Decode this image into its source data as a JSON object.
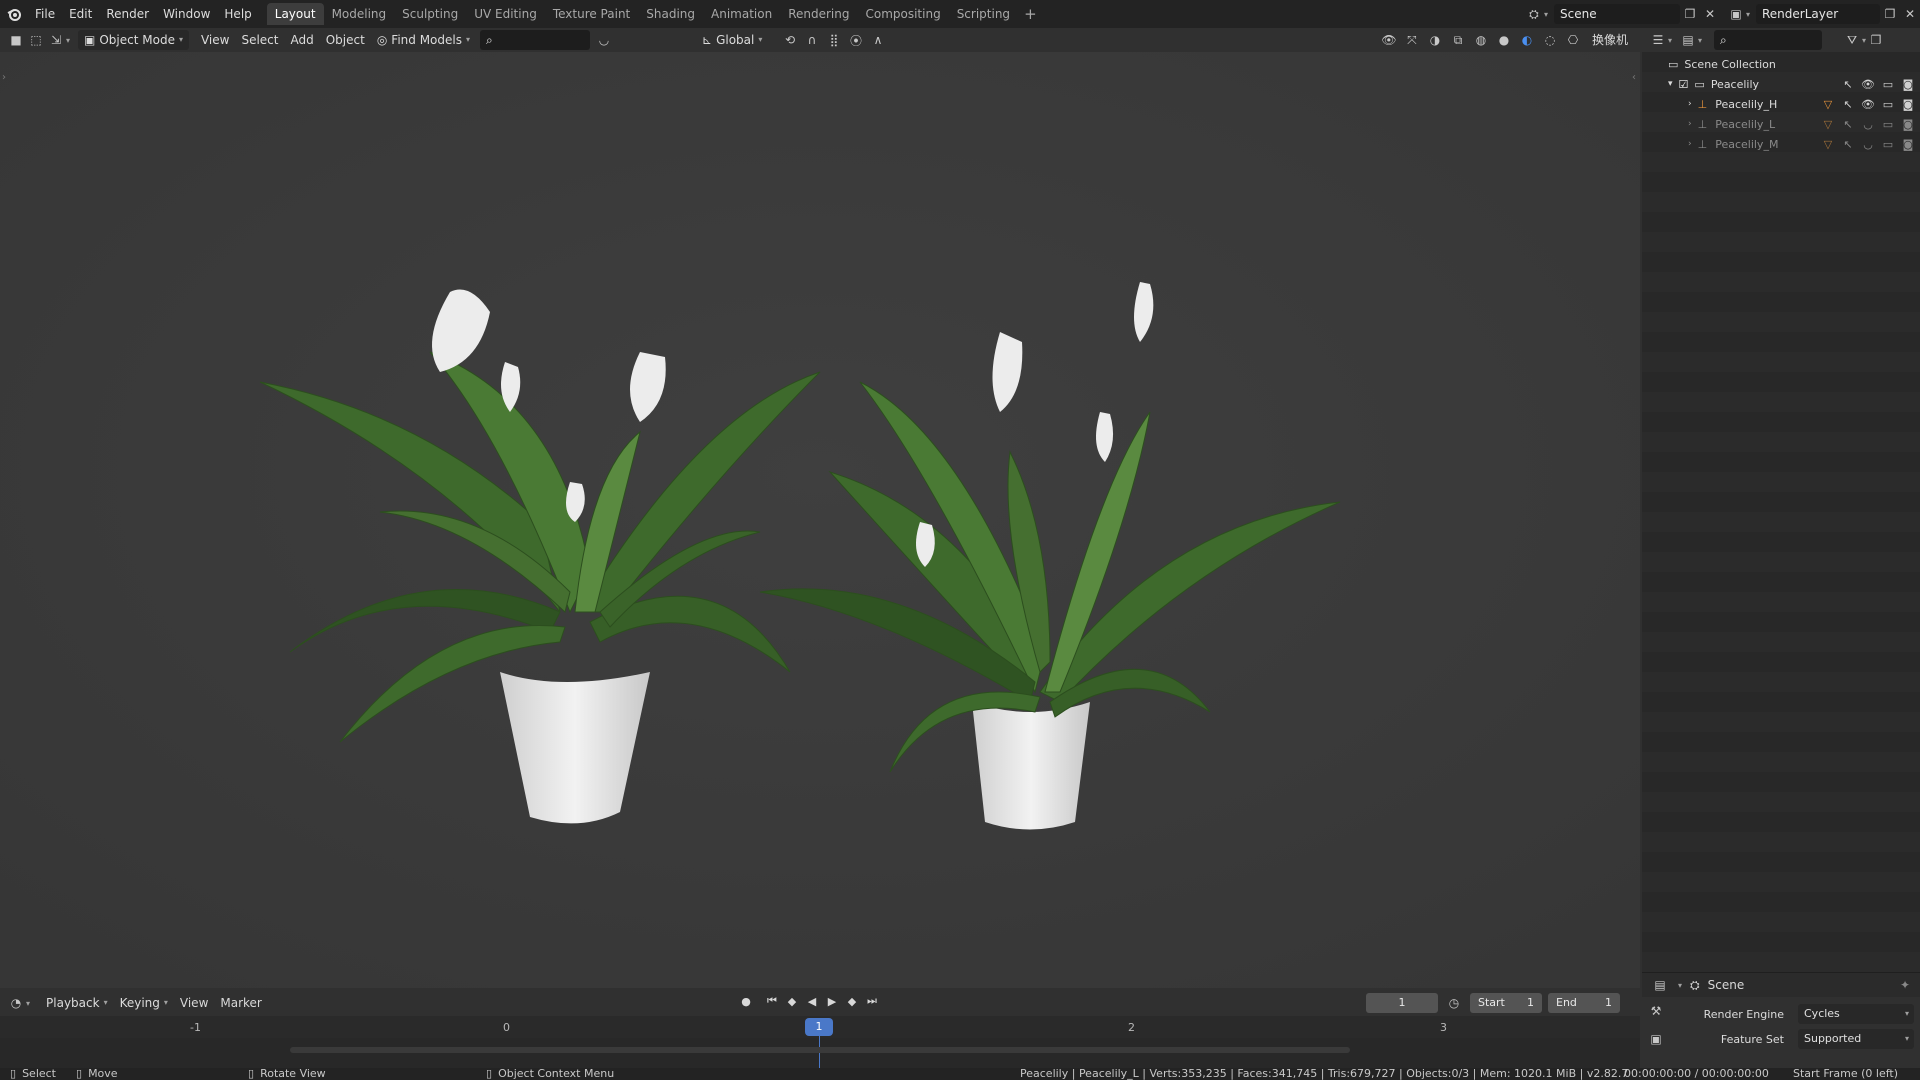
{
  "topbar": {
    "menus": [
      "File",
      "Edit",
      "Render",
      "Window",
      "Help"
    ],
    "workspaces": [
      "Layout",
      "Modeling",
      "Sculpting",
      "UV Editing",
      "Texture Paint",
      "Shading",
      "Animation",
      "Rendering",
      "Compositing",
      "Scripting"
    ],
    "active_workspace": "Layout",
    "scene_name": "Scene",
    "view_layer": "RenderLayer"
  },
  "viewport_header": {
    "mode": "Object Mode",
    "menus": [
      "View",
      "Select",
      "Add",
      "Object"
    ],
    "addon": "Find Models",
    "search_placeholder": "",
    "orientation": "Global",
    "camera_btn": "换像机"
  },
  "outliner": {
    "collection": "Scene Collection",
    "items": [
      {
        "name": "Peacelily",
        "level": 0
      },
      {
        "name": "Peacelily_H",
        "level": 1
      },
      {
        "name": "Peacelily_L",
        "level": 1
      },
      {
        "name": "Peacelily_M",
        "level": 1
      }
    ]
  },
  "properties": {
    "context": "Scene",
    "render_engine_label": "Render Engine",
    "render_engine": "Cycles",
    "feature_set_label": "Feature Set",
    "feature_set": "Supported"
  },
  "timeline": {
    "menus": [
      "Playback",
      "Keying",
      "View",
      "Marker"
    ],
    "current_frame": "1",
    "start_label": "Start",
    "start": "1",
    "end_label": "End",
    "end": "1",
    "ruler": [
      "-1",
      "0",
      "1",
      "2",
      "3"
    ]
  },
  "statusbar": {
    "select": "Select",
    "move": "Move",
    "rotate": "Rotate View",
    "context_menu": "Object Context Menu",
    "stats": "Peacelily | Peacelily_L | Verts:353,235 | Faces:341,745 | Tris:679,727 | Objects:0/3 | Mem: 1020.1 MiB | v2.82.7",
    "time": "00:00:00:00 / 00:00:00:00",
    "start_frame": "Start Frame (0 left)"
  }
}
